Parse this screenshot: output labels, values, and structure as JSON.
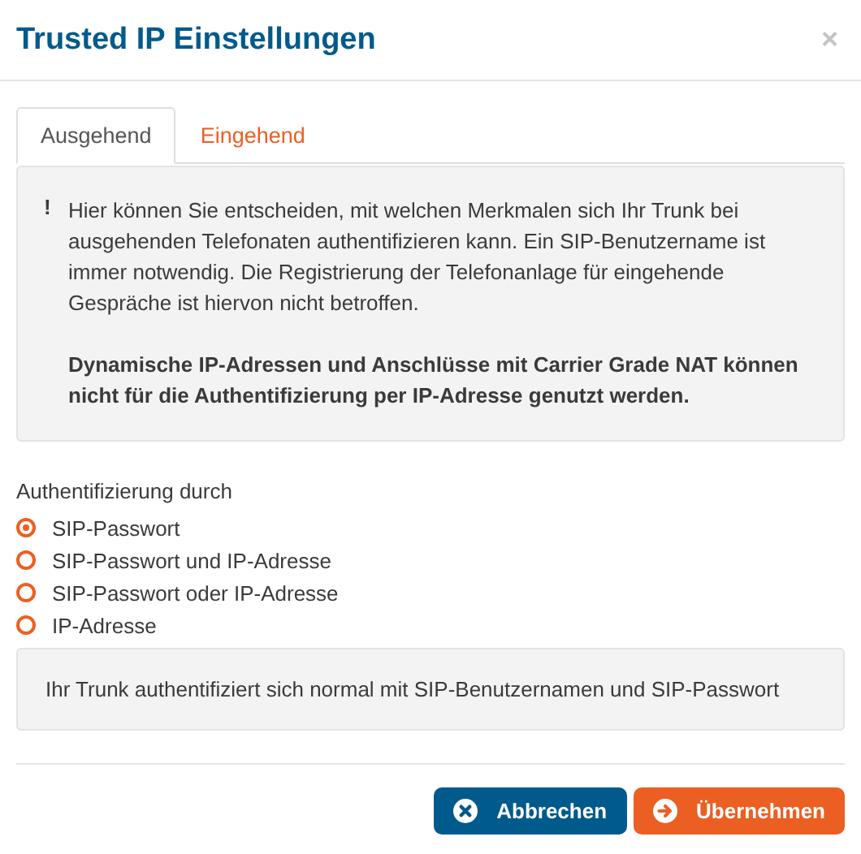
{
  "dialog": {
    "title": "Trusted IP Einstellungen",
    "close": "×"
  },
  "tabs": [
    {
      "label": "Ausgehend",
      "selected": true
    },
    {
      "label": "Eingehend",
      "selected": false
    }
  ],
  "notice": {
    "mark": "!",
    "text": "Hier können Sie entscheiden, mit welchen Merkmalen sich Ihr Trunk bei ausgehenden Telefonaten authentifizieren kann. Ein SIP-Benutzername ist immer notwendig. Die Registrierung der Telefonanlage für eingehende Gespräche ist hiervon nicht betroffen.",
    "warning": "Dynamische IP-Adressen und Anschlüsse mit Carrier Grade NAT können nicht für die Authentifizierung per IP-Adresse genutzt werden."
  },
  "auth": {
    "label": "Authentifizierung durch",
    "options": [
      {
        "label": "SIP-Passwort",
        "selected": true
      },
      {
        "label": "SIP-Passwort und IP-Adresse",
        "selected": false
      },
      {
        "label": "SIP-Passwort oder IP-Adresse",
        "selected": false
      },
      {
        "label": "IP-Adresse",
        "selected": false
      }
    ],
    "description": "Ihr Trunk authentifiziert sich normal mit SIP-Benutzernamen und SIP-Passwort"
  },
  "buttons": [
    {
      "label": "Abbrechen",
      "kind": "cancel"
    },
    {
      "label": "Übernehmen",
      "kind": "submit"
    }
  ]
}
